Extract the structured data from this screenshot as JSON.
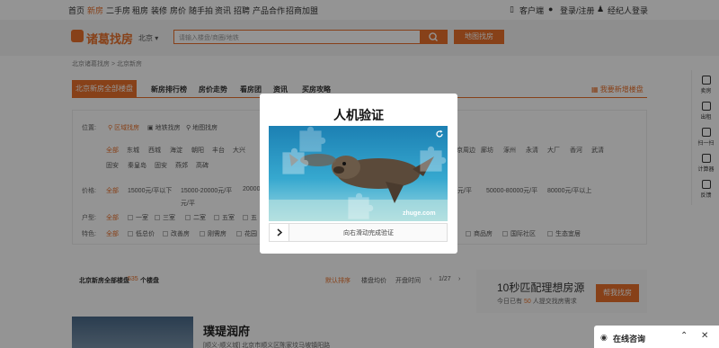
{
  "topnav": {
    "left_links": [
      "首页",
      "新房",
      "二手房",
      "租房",
      "装修",
      "房价",
      "随手拍",
      "资讯",
      "招聘",
      "产品合作",
      "招商加盟"
    ],
    "active_index": 1,
    "client": "客户端",
    "login": "登录/注册",
    "agent_login": "经纪人登录"
  },
  "header": {
    "logo_text": "诸葛找房",
    "city": "北京",
    "search_placeholder": "请输入楼盘/商圈/地铁",
    "map_button": "地图找房"
  },
  "breadcrumb": "北京诸葛找房 > 北京新房",
  "tabs": {
    "active": "北京新房全部楼盘",
    "items": [
      "新房排行榜",
      "房价走势",
      "看房团",
      "资讯",
      "买房攻略"
    ],
    "right_link": "我要新增楼盘"
  },
  "filters": {
    "position_label": "位置:",
    "position_modes": [
      "区域找房",
      "地铁找房",
      "地图找房"
    ],
    "area_row1": [
      "全部",
      "东城",
      "西城",
      "海淀",
      "朝阳",
      "丰台",
      "大兴"
    ],
    "area_row1_right": [
      "北京周边",
      "廊坊",
      "涿州",
      "永清",
      "大厂",
      "香河",
      "武清"
    ],
    "area_row2": [
      "固安",
      "秦皇岛",
      "固安",
      "燕郊",
      "高碑"
    ],
    "price_label": "价格:",
    "price_items": [
      "全部",
      "15000元/平以下",
      "15000-20000元/平",
      "20000"
    ],
    "price_items_right": [
      "元/平",
      "50000-80000元/平",
      "80000元/平以上"
    ],
    "price_tail": "元/平",
    "layout_label": "户型:",
    "layout_items": [
      "全部",
      "一室",
      "三室",
      "二室",
      "五室",
      "五"
    ],
    "feature_label": "特色:",
    "feature_items": [
      "全部",
      "低总价",
      "改善房",
      "刚需房",
      "花园"
    ],
    "feature_items_right": [
      "商品房",
      "国际社区",
      "生态宜居"
    ]
  },
  "sortbar": {
    "count_prefix": "北京新房全部楼盘",
    "count": "535",
    "count_suffix": "个楼盘",
    "default_sort": "默认排序",
    "price_sort": "楼盘均价",
    "open_sort": "开盘时间",
    "page": "1/27"
  },
  "promo": {
    "title": "10秒匹配理想房源",
    "subtitle_prefix": "今日已有",
    "subtitle_count": "50",
    "subtitle_suffix": "人提交找房需求",
    "button": "帮我找房"
  },
  "listing": {
    "title": "璞瑅润府",
    "address": "[顺义-顺义城] 北京市顺义区陈家坟马坡镇阳路"
  },
  "sidebar": [
    "卖房",
    "出租",
    "扫一扫",
    "计算器",
    "反馈"
  ],
  "captcha": {
    "title": "人机验证",
    "watermark": "zhuge.com",
    "slider_text": "向右滑动完成验证"
  },
  "chat": {
    "label": "在线咨询"
  },
  "colors": {
    "accent": "#e8712b",
    "overlay": "rgba(0,0,0,0.42)"
  }
}
